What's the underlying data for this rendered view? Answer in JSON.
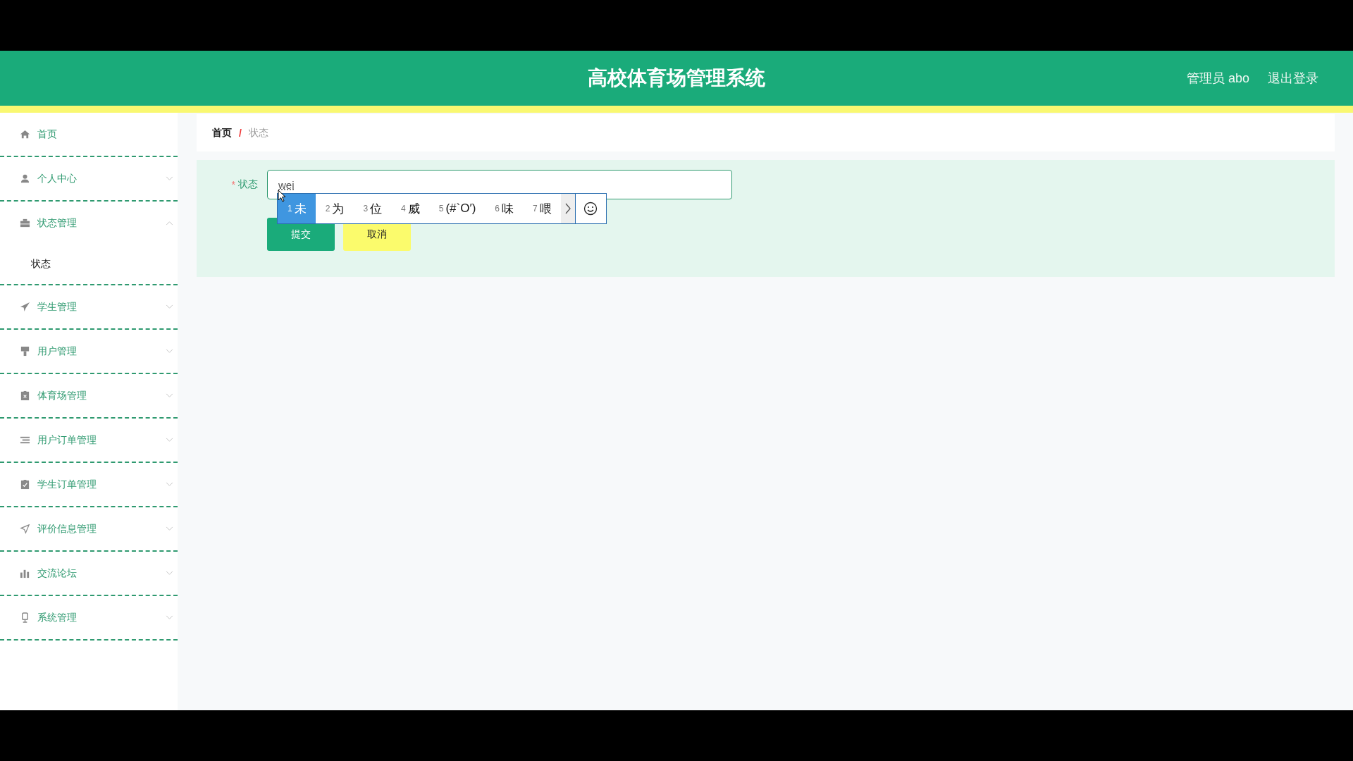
{
  "header": {
    "title": "高校体育场管理系统",
    "user": "管理员 abo",
    "logout": "退出登录"
  },
  "sidebar": {
    "items": [
      {
        "label": "首页"
      },
      {
        "label": "个人中心",
        "expanded": false
      },
      {
        "label": "状态管理",
        "expanded": true,
        "children": [
          {
            "label": "状态"
          }
        ]
      },
      {
        "label": "学生管理",
        "expanded": false
      },
      {
        "label": "用户管理",
        "expanded": false
      },
      {
        "label": "体育场管理",
        "expanded": false
      },
      {
        "label": "用户订单管理",
        "expanded": false
      },
      {
        "label": "学生订单管理",
        "expanded": false
      },
      {
        "label": "评价信息管理",
        "expanded": false
      },
      {
        "label": "交流论坛",
        "expanded": false
      },
      {
        "label": "系统管理",
        "expanded": false
      }
    ]
  },
  "breadcrumb": {
    "items": [
      "首页",
      "状态"
    ],
    "separator": "/"
  },
  "form": {
    "label": "状态",
    "required_mark": "*",
    "value": "wei"
  },
  "ime": {
    "candidates": [
      {
        "number": "1",
        "text": "未",
        "selected": true
      },
      {
        "number": "2",
        "text": "为",
        "selected": false
      },
      {
        "number": "3",
        "text": "位",
        "selected": false
      },
      {
        "number": "4",
        "text": "威",
        "selected": false
      },
      {
        "number": "5",
        "text": "(#`O′)",
        "selected": false
      },
      {
        "number": "6",
        "text": "味",
        "selected": false
      },
      {
        "number": "7",
        "text": "喂",
        "selected": false
      }
    ]
  },
  "buttons": [
    "提交",
    "取消"
  ]
}
